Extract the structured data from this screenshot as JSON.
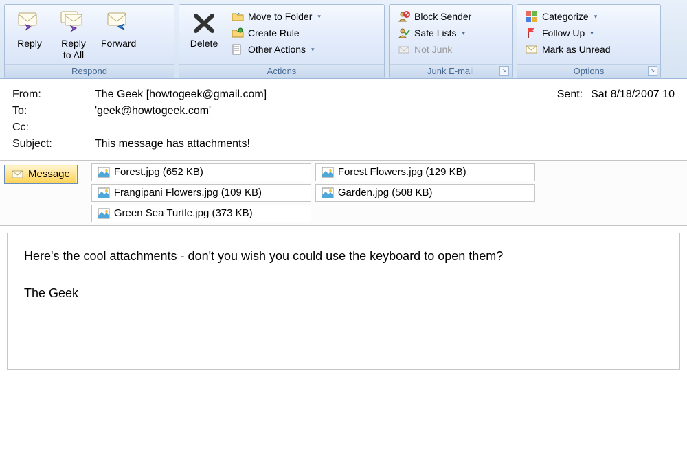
{
  "ribbon": {
    "respond": {
      "title": "Respond",
      "reply": "Reply",
      "reply_all": "Reply\nto All",
      "forward": "Forward"
    },
    "actions": {
      "title": "Actions",
      "delete": "Delete",
      "move": "Move to Folder",
      "create_rule": "Create Rule",
      "other": "Other Actions"
    },
    "junk": {
      "title": "Junk E-mail",
      "block": "Block Sender",
      "safe": "Safe Lists",
      "not_junk": "Not Junk"
    },
    "options": {
      "title": "Options",
      "categorize": "Categorize",
      "follow_up": "Follow Up",
      "mark_unread": "Mark as Unread"
    }
  },
  "header": {
    "from_label": "From:",
    "from_value": "The Geek [howtogeek@gmail.com]",
    "sent_label": "Sent:",
    "sent_value": "Sat 8/18/2007 10",
    "to_label": "To:",
    "to_value": "'geek@howtogeek.com'",
    "cc_label": "Cc:",
    "cc_value": "",
    "subject_label": "Subject:",
    "subject_value": "This message has attachments!"
  },
  "message_tab": "Message",
  "attachments": {
    "row1": {
      "a": "Forest.jpg (652 KB)",
      "b": "Forest Flowers.jpg (129 KB)"
    },
    "row2": {
      "a": "Frangipani Flowers.jpg (109 KB)",
      "b": "Garden.jpg (508 KB)"
    },
    "row3": {
      "a": "Green Sea Turtle.jpg (373 KB)"
    }
  },
  "body": {
    "line1": "Here's the cool attachments - don't you wish you could use the keyboard to open them?",
    "line2": "The Geek"
  }
}
